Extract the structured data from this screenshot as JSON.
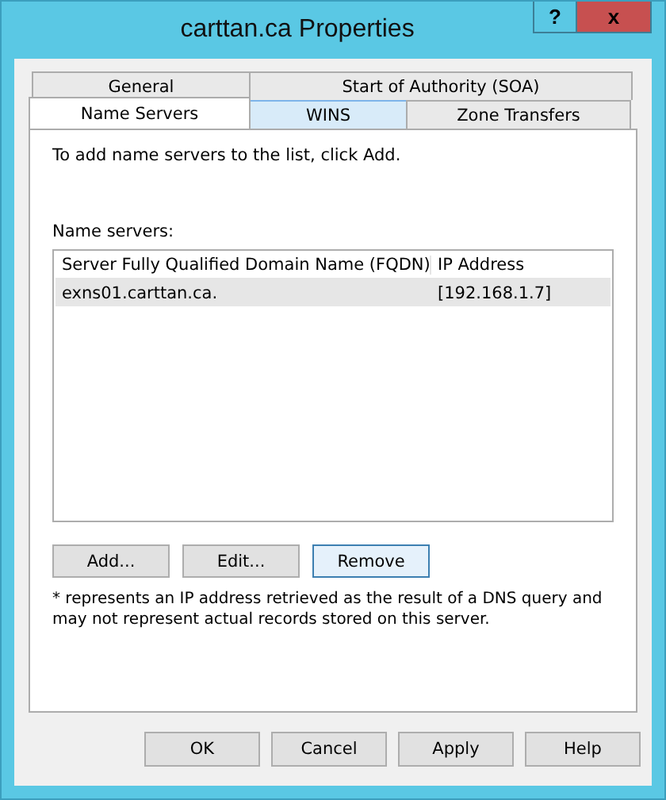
{
  "window": {
    "title": "carttan.ca Properties",
    "help_button": "?",
    "close_button": "x"
  },
  "tab_rows": [
    [
      {
        "label": "General",
        "selected": false,
        "hovered": false
      },
      {
        "label": "Start of Authority (SOA)",
        "selected": false,
        "hovered": false
      }
    ],
    [
      {
        "label": "Name Servers",
        "selected": true,
        "hovered": false
      },
      {
        "label": "WINS",
        "selected": false,
        "hovered": true
      },
      {
        "label": "Zone Transfers",
        "selected": false,
        "hovered": false
      }
    ]
  ],
  "intro": "To add name servers to the list, click Add.",
  "list_label": "Name servers:",
  "list": {
    "columns": [
      "Server Fully Qualified Domain Name (FQDN)",
      "IP Address"
    ],
    "rows": [
      {
        "cells": [
          "exns01.carttan.ca.",
          "[192.168.1.7]"
        ],
        "selected": true
      }
    ]
  },
  "list_buttons": [
    {
      "label": "Add...",
      "focused": false
    },
    {
      "label": "Edit...",
      "focused": false
    },
    {
      "label": "Remove",
      "focused": true
    }
  ],
  "note": "* represents an IP address retrieved as the result of a DNS query and may not represent actual records stored on this server.",
  "dialog_buttons": [
    {
      "label": "OK",
      "focused": false
    },
    {
      "label": "Cancel",
      "focused": false
    },
    {
      "label": "Apply",
      "focused": false
    },
    {
      "label": "Help",
      "focused": false
    }
  ]
}
